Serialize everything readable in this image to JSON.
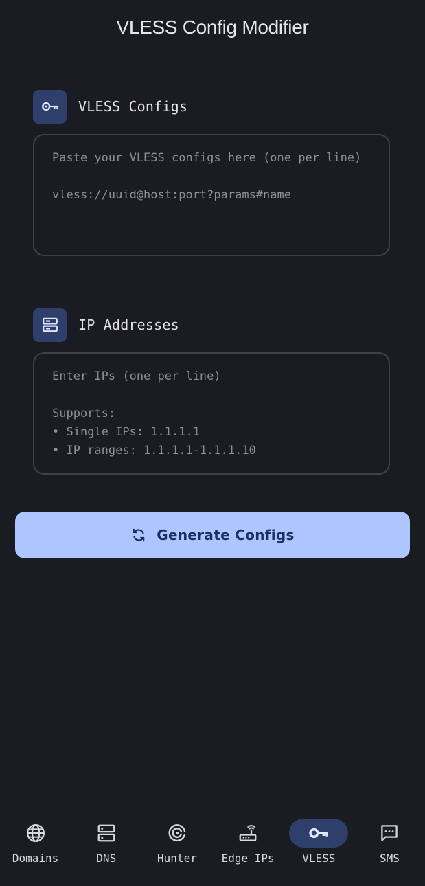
{
  "header": {
    "title": "VLESS Config Modifier"
  },
  "vless_section": {
    "label": "VLESS Configs",
    "icon": "key-icon",
    "placeholder": "Paste your VLESS configs here (one per line)\n\nvless://uuid@host:port?params#name",
    "value": ""
  },
  "ip_section": {
    "label": "IP Addresses",
    "icon": "server-icon",
    "placeholder": "Enter IPs (one per line)\n\nSupports:\n• Single IPs: 1.1.1.1\n• IP ranges: 1.1.1.1-1.1.1.10",
    "value": ""
  },
  "generate_button": {
    "label": "Generate Configs",
    "icon": "sync-icon"
  },
  "bottom_nav": {
    "active": "VLESS",
    "items": [
      {
        "label": "Domains",
        "icon": "globe-icon"
      },
      {
        "label": "DNS",
        "icon": "dns-icon"
      },
      {
        "label": "Hunter",
        "icon": "radar-icon"
      },
      {
        "label": "Edge IPs",
        "icon": "router-icon"
      },
      {
        "label": "VLESS",
        "icon": "key-icon"
      },
      {
        "label": "SMS",
        "icon": "sms-icon"
      }
    ]
  },
  "colors": {
    "background": "#1b1c21",
    "accent": "#adc6ff",
    "icon_container": "#2e3f6b",
    "outline": "#3f4049"
  }
}
